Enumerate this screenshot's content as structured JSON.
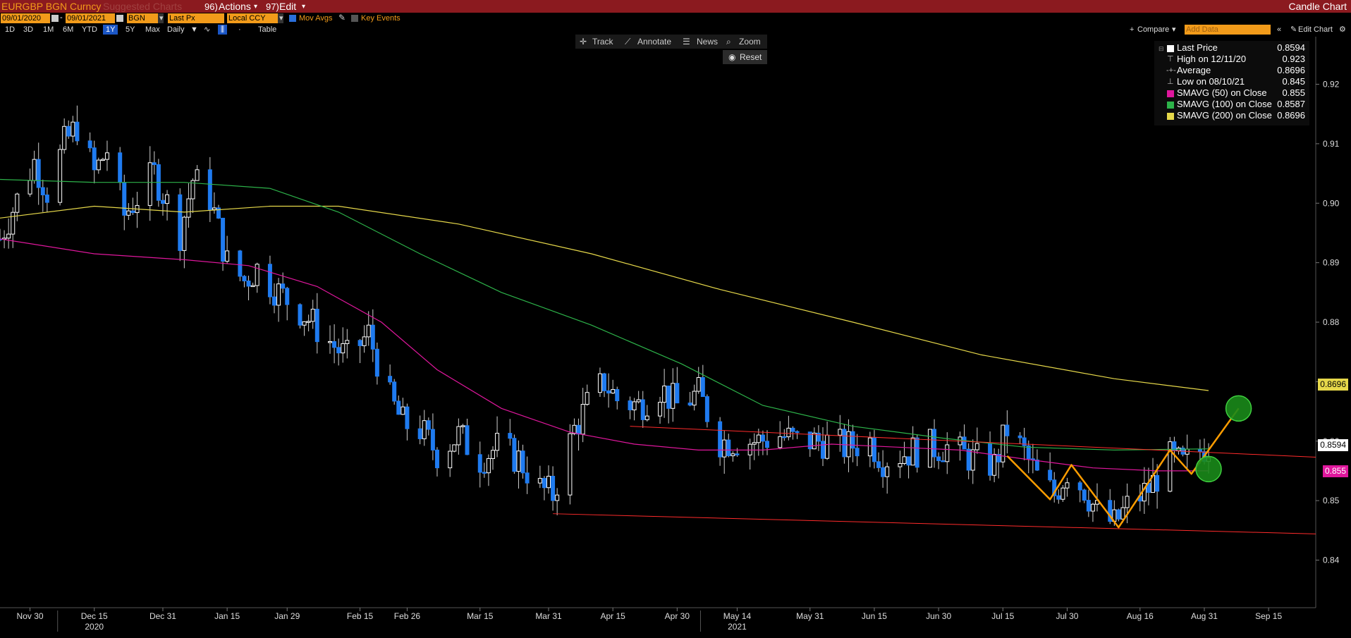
{
  "window": {
    "ticker": "EURGBP BGN Curncy",
    "suggested": "Suggested Charts",
    "actions_num": "96)",
    "actions_label": "Actions",
    "edit_num": "97)",
    "edit_label": "Edit",
    "title": "Candle Chart"
  },
  "params": {
    "start_date": "09/01/2020",
    "end_date": "09/01/2021",
    "source": "BGN",
    "field": "Last Px",
    "currency": "Local CCY",
    "mov_avgs": "Mov Avgs",
    "key_events": "Key Events"
  },
  "periods": [
    "1D",
    "3D",
    "1M",
    "6M",
    "YTD",
    "1Y",
    "5Y",
    "Max"
  ],
  "selected_period": "1Y",
  "frequency": "Daily",
  "table_label": "Table",
  "compare_label": "Compare",
  "add_data_placeholder": "Add Data",
  "edit_chart_label": "Edit Chart",
  "tools": {
    "track": "Track",
    "annotate": "Annotate",
    "news": "News",
    "zoom": "Zoom",
    "reset": "Reset"
  },
  "legend": [
    {
      "label": "Last Price",
      "value": "0.8594",
      "color": "#ffffff",
      "icon": "square"
    },
    {
      "label": "High on 12/11/20",
      "value": "0.923",
      "color": "#bbbbbb",
      "icon": "high-marker"
    },
    {
      "label": "Average",
      "value": "0.8696",
      "color": "#bbbbbb",
      "icon": "average-marker"
    },
    {
      "label": "Low on 08/10/21",
      "value": "0.845",
      "color": "#bbbbbb",
      "icon": "low-marker"
    },
    {
      "label": "SMAVG (50)  on Close",
      "value": "0.855",
      "color": "#e0179d",
      "icon": "square"
    },
    {
      "label": "SMAVG (100)  on Close",
      "value": "0.8587",
      "color": "#2db34a",
      "icon": "square"
    },
    {
      "label": "SMAVG (200)  on Close",
      "value": "0.8696",
      "color": "#e6d84a",
      "icon": "square"
    }
  ],
  "price_labels": [
    {
      "value": "0.8696",
      "y": 0.8696,
      "bg": "#e6d84a",
      "fg": "#000000"
    },
    {
      "value": "0.8594",
      "y": 0.8594,
      "bg": "#ffffff",
      "fg": "#000000"
    },
    {
      "value": "0.855",
      "y": 0.855,
      "bg": "#e0179d",
      "fg": "#ffffff"
    }
  ],
  "chart_data": {
    "type": "candlestick",
    "ylim": [
      0.832,
      0.928
    ],
    "y_ticks": [
      "0.84",
      "0.85",
      "0.86",
      "0.87",
      "0.88",
      "0.89",
      "0.90",
      "0.91",
      "0.92"
    ],
    "x_range": [
      "2020-11-23",
      "2021-09-26"
    ],
    "x_ticks": [
      {
        "date": "2020-11-30",
        "label": "Nov 30"
      },
      {
        "date": "2020-12-15",
        "label": "Dec 15",
        "year": "2020"
      },
      {
        "date": "2020-12-31",
        "label": "Dec 31"
      },
      {
        "date": "2021-01-15",
        "label": "Jan 15"
      },
      {
        "date": "2021-01-29",
        "label": "Jan 29"
      },
      {
        "date": "2021-02-15",
        "label": "Feb 15"
      },
      {
        "date": "2021-02-26",
        "label": "Feb 26"
      },
      {
        "date": "2021-03-15",
        "label": "Mar 15"
      },
      {
        "date": "2021-03-31",
        "label": "Mar 31"
      },
      {
        "date": "2021-04-15",
        "label": "Apr 15"
      },
      {
        "date": "2021-04-30",
        "label": "Apr 30"
      },
      {
        "date": "2021-05-14",
        "label": "May 14",
        "year": "2021"
      },
      {
        "date": "2021-05-31",
        "label": "May 31"
      },
      {
        "date": "2021-06-15",
        "label": "Jun 15"
      },
      {
        "date": "2021-06-30",
        "label": "Jun 30"
      },
      {
        "date": "2021-07-15",
        "label": "Jul 15"
      },
      {
        "date": "2021-07-30",
        "label": "Jul 30"
      },
      {
        "date": "2021-08-16",
        "label": "Aug 16"
      },
      {
        "date": "2021-08-31",
        "label": "Aug 31"
      },
      {
        "date": "2021-09-15",
        "label": "Sep 15"
      }
    ],
    "close_series": [
      [
        "2020-11-23",
        0.894
      ],
      [
        "2020-11-26",
        0.899
      ],
      [
        "2020-12-01",
        0.907
      ],
      [
        "2020-12-04",
        0.902
      ],
      [
        "2020-12-08",
        0.91
      ],
      [
        "2020-12-11",
        0.913
      ],
      [
        "2020-12-15",
        0.905
      ],
      [
        "2020-12-18",
        0.909
      ],
      [
        "2020-12-22",
        0.898
      ],
      [
        "2020-12-29",
        0.905
      ],
      [
        "2021-01-04",
        0.895
      ],
      [
        "2021-01-07",
        0.904
      ],
      [
        "2021-01-11",
        0.901
      ],
      [
        "2021-01-15",
        0.89
      ],
      [
        "2021-01-19",
        0.887
      ],
      [
        "2021-01-22",
        0.889
      ],
      [
        "2021-01-27",
        0.885
      ],
      [
        "2021-02-01",
        0.882
      ],
      [
        "2021-02-05",
        0.879
      ],
      [
        "2021-02-09",
        0.876
      ],
      [
        "2021-02-12",
        0.874
      ],
      [
        "2021-02-17",
        0.878
      ],
      [
        "2021-02-22",
        0.867
      ],
      [
        "2021-02-25",
        0.863
      ],
      [
        "2021-03-01",
        0.862
      ],
      [
        "2021-03-05",
        0.858
      ],
      [
        "2021-03-10",
        0.861
      ],
      [
        "2021-03-15",
        0.857
      ],
      [
        "2021-03-19",
        0.859
      ],
      [
        "2021-03-24",
        0.857
      ],
      [
        "2021-03-29",
        0.852
      ],
      [
        "2021-04-01",
        0.851
      ],
      [
        "2021-04-06",
        0.862
      ],
      [
        "2021-04-09",
        0.866
      ],
      [
        "2021-04-13",
        0.87
      ],
      [
        "2021-04-16",
        0.867
      ],
      [
        "2021-04-21",
        0.866
      ],
      [
        "2021-04-26",
        0.869
      ],
      [
        "2021-04-30",
        0.866
      ],
      [
        "2021-05-05",
        0.868
      ],
      [
        "2021-05-10",
        0.86
      ],
      [
        "2021-05-14",
        0.86
      ],
      [
        "2021-05-19",
        0.86
      ],
      [
        "2021-05-24",
        0.861
      ],
      [
        "2021-05-28",
        0.86
      ],
      [
        "2021-06-03",
        0.86
      ],
      [
        "2021-06-08",
        0.859
      ],
      [
        "2021-06-14",
        0.86
      ],
      [
        "2021-06-17",
        0.857
      ],
      [
        "2021-06-22",
        0.858
      ],
      [
        "2021-06-28",
        0.859
      ],
      [
        "2021-07-02",
        0.859
      ],
      [
        "2021-07-08",
        0.857
      ],
      [
        "2021-07-13",
        0.856
      ],
      [
        "2021-07-16",
        0.862
      ],
      [
        "2021-07-20",
        0.858
      ],
      [
        "2021-07-23",
        0.854
      ],
      [
        "2021-07-27",
        0.851
      ],
      [
        "2021-07-30",
        0.855
      ],
      [
        "2021-08-03",
        0.852
      ],
      [
        "2021-08-06",
        0.848
      ],
      [
        "2021-08-10",
        0.846
      ],
      [
        "2021-08-13",
        0.849
      ],
      [
        "2021-08-18",
        0.852
      ],
      [
        "2021-08-23",
        0.857
      ],
      [
        "2021-08-26",
        0.856
      ],
      [
        "2021-08-31",
        0.859
      ],
      [
        "2021-09-01",
        0.8594
      ]
    ],
    "sma50": [
      [
        "2020-11-23",
        0.894
      ],
      [
        "2020-12-15",
        0.8915
      ],
      [
        "2021-01-05",
        0.8905
      ],
      [
        "2021-01-20",
        0.8895
      ],
      [
        "2021-02-05",
        0.886
      ],
      [
        "2021-02-20",
        0.88
      ],
      [
        "2021-03-05",
        0.872
      ],
      [
        "2021-03-20",
        0.8655
      ],
      [
        "2021-04-05",
        0.8615
      ],
      [
        "2021-04-20",
        0.8595
      ],
      [
        "2021-05-05",
        0.8585
      ],
      [
        "2021-05-20",
        0.8585
      ],
      [
        "2021-06-05",
        0.8595
      ],
      [
        "2021-06-20",
        0.859
      ],
      [
        "2021-07-05",
        0.8585
      ],
      [
        "2021-07-20",
        0.857
      ],
      [
        "2021-08-05",
        0.8555
      ],
      [
        "2021-08-20",
        0.855
      ],
      [
        "2021-09-01",
        0.855
      ]
    ],
    "sma100": [
      [
        "2020-11-23",
        0.904
      ],
      [
        "2020-12-15",
        0.9035
      ],
      [
        "2021-01-05",
        0.9035
      ],
      [
        "2021-01-25",
        0.9025
      ],
      [
        "2021-02-10",
        0.8985
      ],
      [
        "2021-03-01",
        0.8915
      ],
      [
        "2021-03-20",
        0.885
      ],
      [
        "2021-04-10",
        0.8795
      ],
      [
        "2021-05-01",
        0.873
      ],
      [
        "2021-05-20",
        0.866
      ],
      [
        "2021-06-10",
        0.8625
      ],
      [
        "2021-07-01",
        0.8605
      ],
      [
        "2021-07-20",
        0.859
      ],
      [
        "2021-08-10",
        0.8585
      ],
      [
        "2021-09-01",
        0.8587
      ]
    ],
    "sma200": [
      [
        "2020-11-23",
        0.8975
      ],
      [
        "2020-12-15",
        0.8995
      ],
      [
        "2021-01-05",
        0.8985
      ],
      [
        "2021-01-25",
        0.8995
      ],
      [
        "2021-02-10",
        0.8995
      ],
      [
        "2021-03-10",
        0.8965
      ],
      [
        "2021-04-10",
        0.8915
      ],
      [
        "2021-05-10",
        0.8855
      ],
      [
        "2021-06-10",
        0.88
      ],
      [
        "2021-07-10",
        0.8745
      ],
      [
        "2021-08-10",
        0.8705
      ],
      [
        "2021-09-01",
        0.8685
      ]
    ],
    "trendlines": [
      {
        "name": "upper-resistance",
        "color": "#ff2b2b",
        "from": [
          "2021-04-19",
          0.8625
        ],
        "to": [
          "2021-09-26",
          0.8573
        ]
      },
      {
        "name": "lower-support",
        "color": "#ff2b2b",
        "from": [
          "2021-04-01",
          0.8478
        ],
        "to": [
          "2021-09-26",
          0.8444
        ]
      }
    ],
    "pattern": {
      "color": "#ff9d00",
      "points": [
        [
          "2021-07-16",
          0.8575
        ],
        [
          "2021-07-26",
          0.8502
        ],
        [
          "2021-07-31",
          0.856
        ],
        [
          "2021-08-11",
          0.8455
        ],
        [
          "2021-08-23",
          0.8585
        ],
        [
          "2021-08-28",
          0.8545
        ],
        [
          "2021-09-08",
          0.8655
        ]
      ]
    },
    "markers": [
      {
        "date": "2021-09-08",
        "y": 0.8655,
        "color": "#1a8a1a"
      },
      {
        "date": "2021-09-01",
        "y": 0.8553,
        "color": "#1a8a1a"
      }
    ]
  }
}
